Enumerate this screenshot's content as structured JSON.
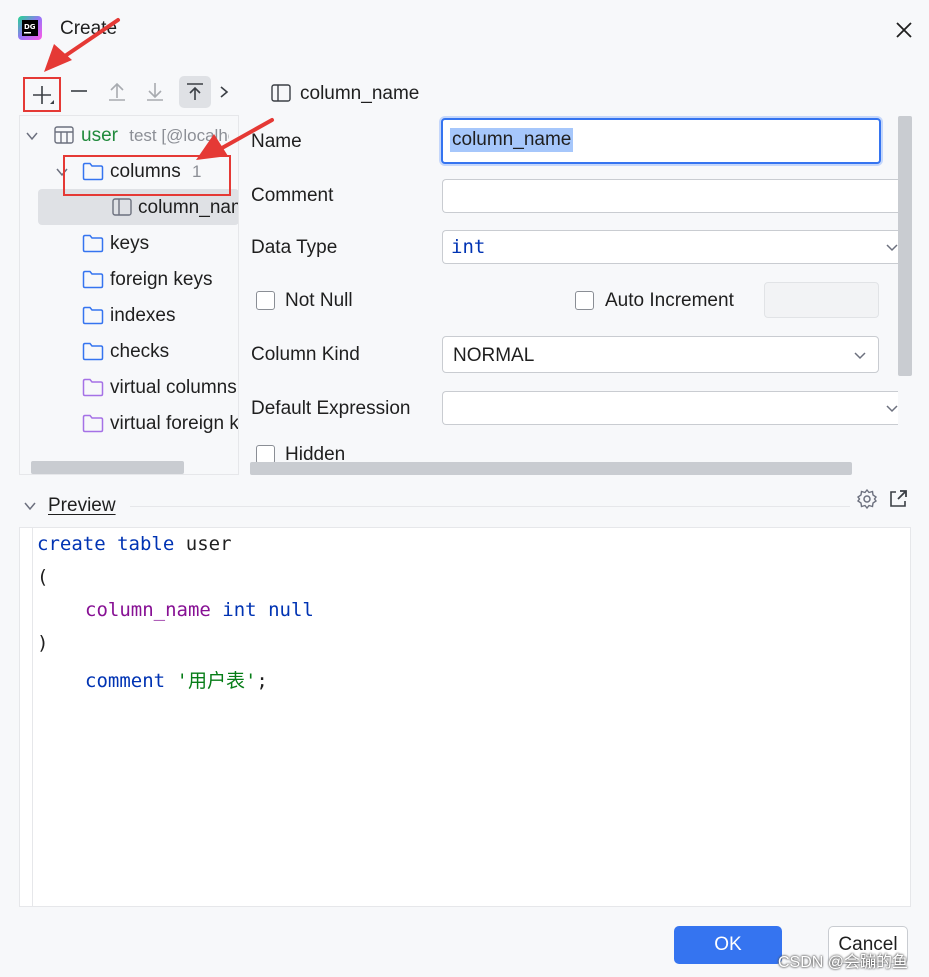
{
  "window": {
    "title": "Create"
  },
  "tree": {
    "table_name": "user",
    "table_schema": "test [@localhost]",
    "columns_folder": {
      "label": "columns",
      "count": "1"
    },
    "column_item": "column_name",
    "folders": [
      "keys",
      "foreign keys",
      "indexes",
      "checks",
      "virtual columns",
      "virtual foreign keys"
    ]
  },
  "editor": {
    "header": "column_name",
    "name_label": "Name",
    "name_value": "column_name",
    "comment_label": "Comment",
    "comment_value": "",
    "data_type_label": "Data Type",
    "data_type_value": "int",
    "not_null_label": "Not Null",
    "auto_increment_label": "Auto Increment",
    "column_kind_label": "Column Kind",
    "column_kind_value": "NORMAL",
    "default_expression_label": "Default Expression",
    "default_expression_value": "",
    "hidden_label": "Hidden"
  },
  "preview": {
    "title": "Preview",
    "kw_create": "create",
    "kw_table": "table",
    "table_name": "user",
    "open_paren": "(",
    "column_name": "column_name",
    "kw_int": "int",
    "kw_null": "null",
    "close_paren": ")",
    "kw_comment": "comment",
    "comment_value": "'用户表'",
    "semicolon": ";"
  },
  "buttons": {
    "ok": "OK",
    "cancel": "Cancel"
  },
  "watermark": "CSDN @会蹦的鱼",
  "colors": {
    "accent": "#3574f0",
    "annotation": "#e53935",
    "keyword": "#0033b3",
    "column": "#871094",
    "string": "#067d17"
  }
}
